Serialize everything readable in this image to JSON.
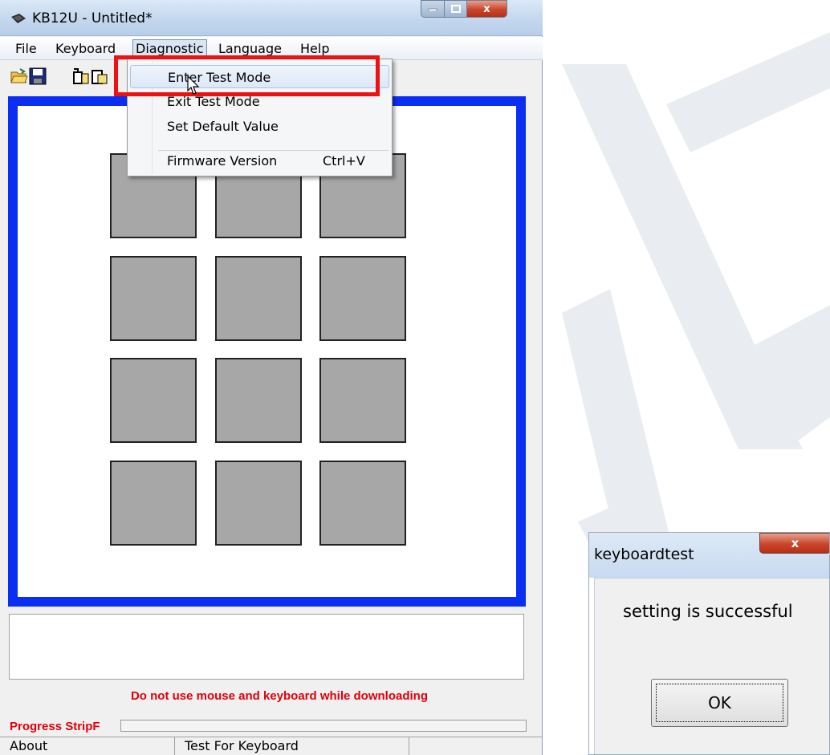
{
  "window": {
    "title": "KB12U - Untitled*",
    "caption_close": "x"
  },
  "menubar": {
    "items": [
      "File",
      "Keyboard",
      "Diagnostic",
      "Language",
      "Help"
    ]
  },
  "diagnostic_menu": {
    "items": [
      {
        "label": "Enter Test Mode",
        "shortcut": ""
      },
      {
        "label": "Exit Test Mode",
        "shortcut": ""
      },
      {
        "label": "Set Default Value",
        "shortcut": ""
      },
      {
        "label": "Firmware Version",
        "shortcut": "Ctrl+V"
      }
    ]
  },
  "keypad": {
    "rows": 4,
    "cols": 3,
    "key_color": "#a7a7a7",
    "border_color": "#0a2ef2"
  },
  "warning_text": "Do not use mouse and keyboard while downloading",
  "progress": {
    "label": "Progress StripF",
    "value": 0
  },
  "statusbar": {
    "panes": [
      "About",
      "Test For Keyboard",
      ""
    ]
  },
  "dialog": {
    "title": "keyboardtest",
    "close_label": "x",
    "message": "setting is successful",
    "ok_label": "OK"
  },
  "colors": {
    "highlight": "#ee1111",
    "warning": "#e0000b"
  }
}
